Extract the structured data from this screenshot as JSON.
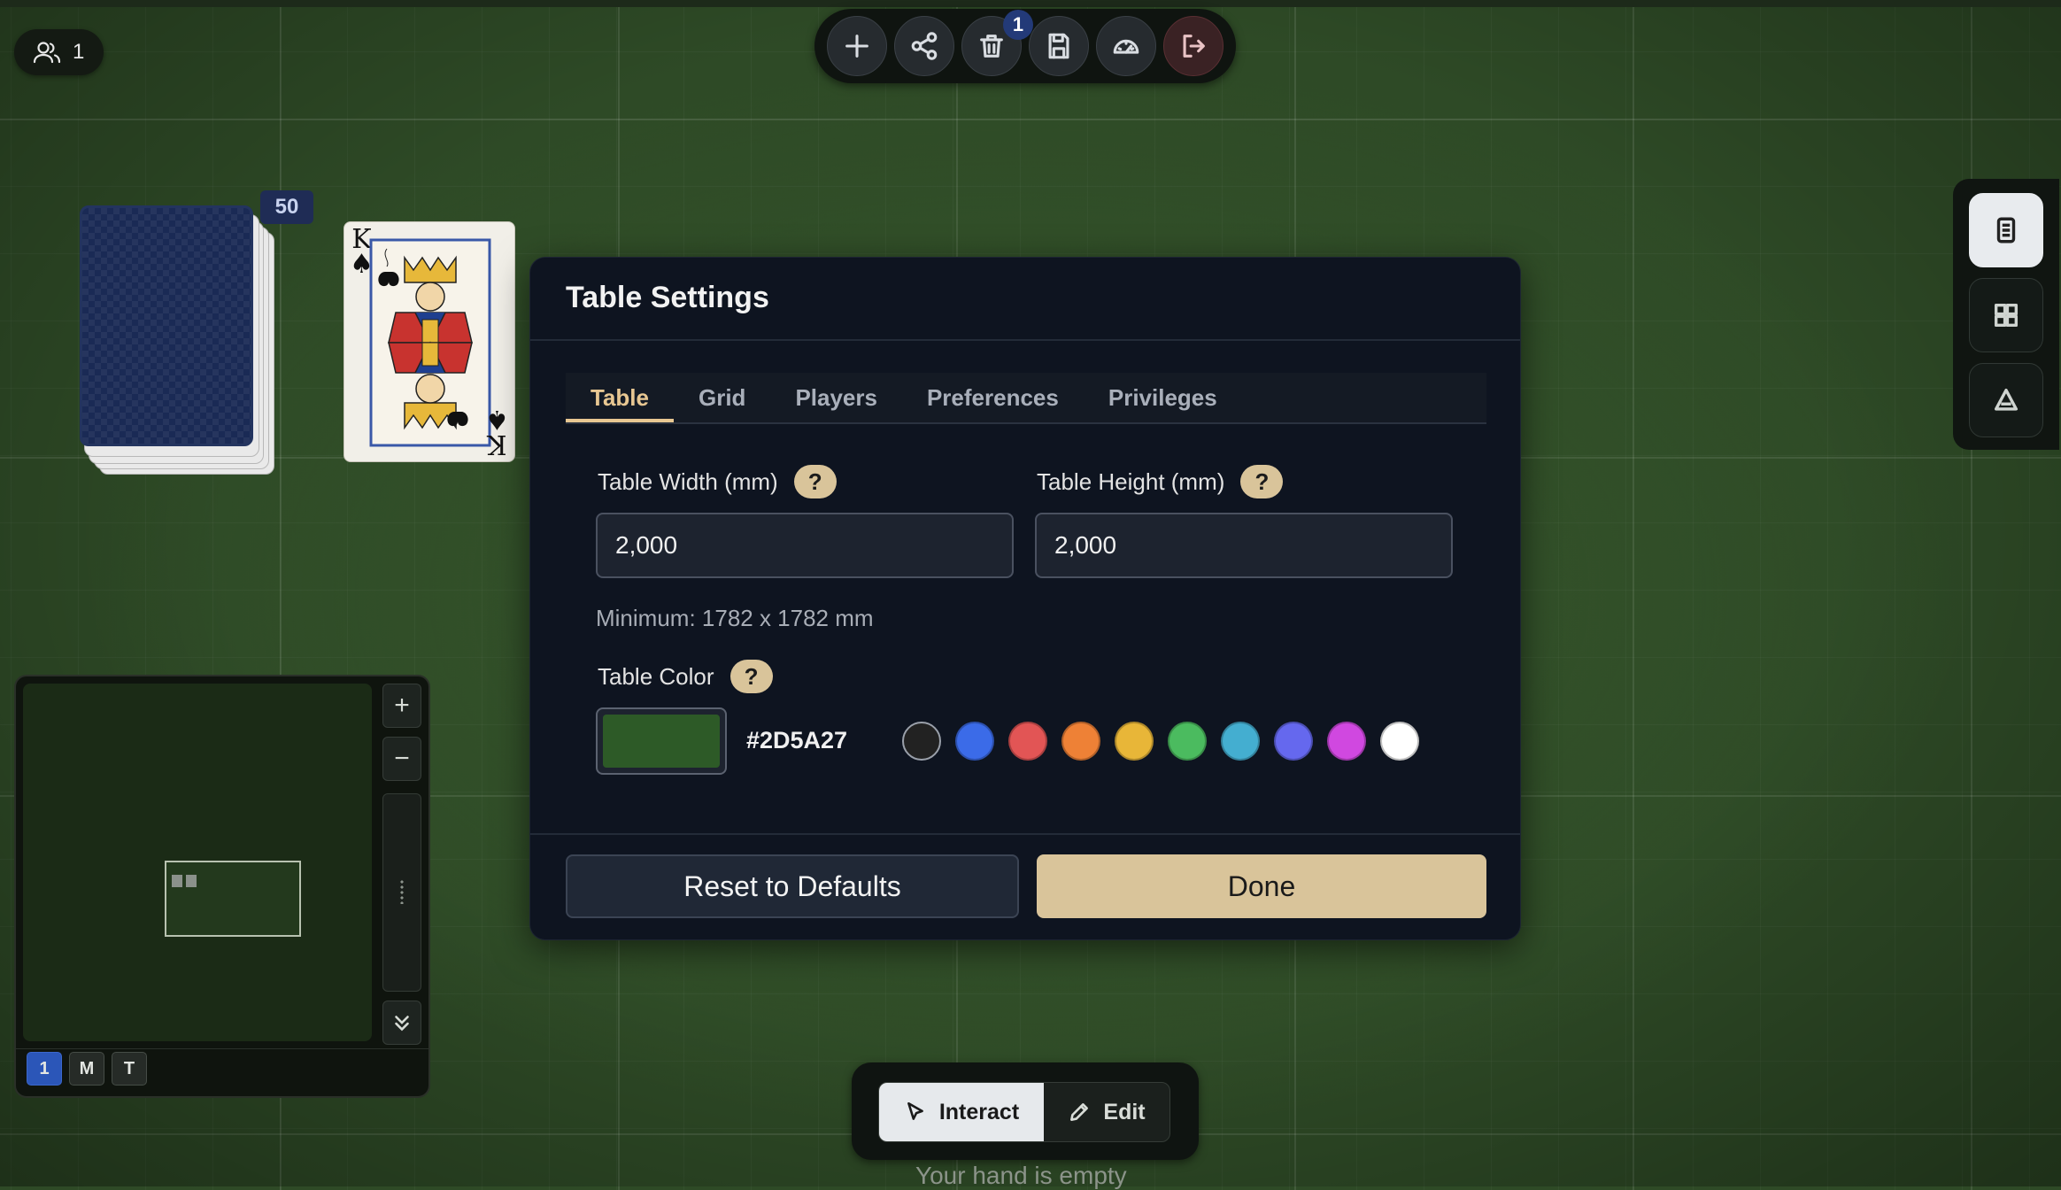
{
  "players": {
    "count": "1",
    "icon": "users-icon"
  },
  "toolbar": {
    "buttons": [
      {
        "name": "add",
        "icon": "plus-icon"
      },
      {
        "name": "share",
        "icon": "share-icon"
      },
      {
        "name": "trash",
        "icon": "trash-icon",
        "badge": "1"
      },
      {
        "name": "save",
        "icon": "save-icon"
      },
      {
        "name": "performance",
        "icon": "gauge-icon"
      },
      {
        "name": "exit",
        "icon": "logout-icon"
      }
    ],
    "trash_badge": "1"
  },
  "table": {
    "deck_count": "50",
    "deck_back_color": "#1A2A55",
    "card_face": {
      "rank": "K",
      "suit": "♠"
    }
  },
  "modal": {
    "title": "Table Settings",
    "tabs": [
      {
        "label": "Table",
        "active": true
      },
      {
        "label": "Grid",
        "active": false
      },
      {
        "label": "Players",
        "active": false
      },
      {
        "label": "Preferences",
        "active": false
      },
      {
        "label": "Privileges",
        "active": false
      }
    ],
    "width_label": "Table Width (mm)",
    "height_label": "Table Height (mm)",
    "help_glyph": "?",
    "width_value": "2,000",
    "height_value": "2,000",
    "minimum_hint": "Minimum: 1782 x 1782 mm",
    "color_label": "Table Color",
    "color_hex": "#2D5A27",
    "color_presets": [
      "#222222",
      "#3B6BE8",
      "#E25555",
      "#EE8136",
      "#E8B638",
      "#4BBB5F",
      "#44AED0",
      "#6568EE",
      "#D048E0",
      "#FFFFFF"
    ],
    "reset_label": "Reset to Defaults",
    "done_label": "Done"
  },
  "minimap": {
    "zoom_in": "+",
    "zoom_out": "−",
    "layers": [
      {
        "label": "1",
        "active": true
      },
      {
        "label": "M",
        "active": false
      },
      {
        "label": "T",
        "active": false
      }
    ]
  },
  "side_panel": {
    "buttons": [
      {
        "name": "notes",
        "icon": "document-icon",
        "active": true
      },
      {
        "name": "layout",
        "icon": "grid-icon",
        "active": false
      },
      {
        "name": "shapes",
        "icon": "triangle-icon",
        "active": false
      }
    ]
  },
  "mode": {
    "interact_label": "Interact",
    "edit_label": "Edit",
    "active": "Interact"
  },
  "hand": {
    "status": "Your hand is empty"
  },
  "colors": {
    "accent": "#D9C49A",
    "tab_active": "#E8C792",
    "table_bg": "#2D5A27",
    "modal_bg": "#0E1420"
  }
}
